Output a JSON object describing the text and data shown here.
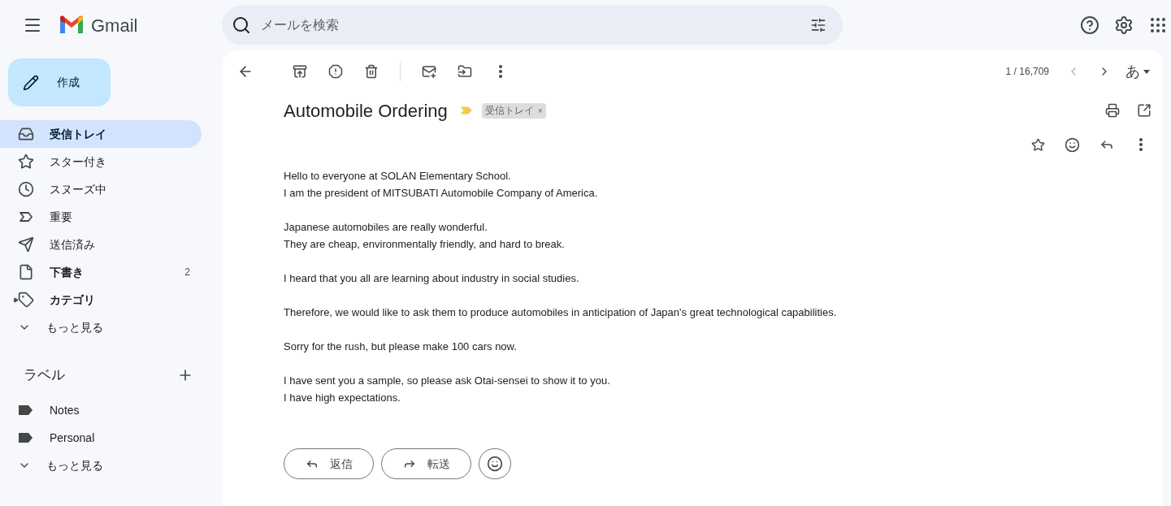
{
  "header": {
    "app_name": "Gmail",
    "search": {
      "placeholder": "メールを検索"
    }
  },
  "compose": {
    "label": "作成"
  },
  "nav": [
    {
      "kind": "inbox",
      "label": "受信トレイ",
      "selected": true,
      "unread": true
    },
    {
      "kind": "starred",
      "label": "スター付き",
      "selected": false,
      "unread": false
    },
    {
      "kind": "snoozed",
      "label": "スヌーズ中",
      "selected": false,
      "unread": false
    },
    {
      "kind": "important",
      "label": "重要",
      "selected": false,
      "unread": false
    },
    {
      "kind": "sent",
      "label": "送信済み",
      "selected": false,
      "unread": false
    },
    {
      "kind": "drafts",
      "label": "下書き",
      "selected": false,
      "unread": true,
      "count": "2"
    },
    {
      "kind": "category",
      "label": "カテゴリ",
      "selected": false,
      "unread": true
    },
    {
      "kind": "more",
      "label": "もっと見る",
      "selected": false,
      "unread": false
    }
  ],
  "labels": {
    "title": "ラベル",
    "items": [
      {
        "kind": "label",
        "label": "Notes"
      },
      {
        "kind": "label",
        "label": "Personal"
      },
      {
        "kind": "more",
        "label": "もっと見る"
      }
    ]
  },
  "toolbar": {
    "counter": "1 / 16,709",
    "input_tool": "あ"
  },
  "message": {
    "subject": "Automobile Ordering",
    "important": true,
    "tag": "受信トレイ",
    "tag_remove": "×",
    "paragraphs": [
      [
        "Hello to everyone at SOLAN Elementary School.",
        "I am the president of MITSUBATI Automobile Company of America."
      ],
      [
        "Japanese automobiles are really wonderful.",
        "They are cheap, environmentally friendly, and hard to break."
      ],
      [
        "I heard that you all are learning about industry in social studies."
      ],
      [
        "Therefore, we would like to ask them to produce automobiles in anticipation of Japan's great technological capabilities."
      ],
      [
        "Sorry for the rush, but please make 100 cars now."
      ],
      [
        "I have sent you a sample, so please ask Otai-sensei to show it to you.",
        "I have high expectations."
      ]
    ]
  },
  "actions": [
    {
      "kind": "reply",
      "label": "返信"
    },
    {
      "kind": "forward",
      "label": "転送"
    },
    {
      "kind": "emoji"
    }
  ]
}
